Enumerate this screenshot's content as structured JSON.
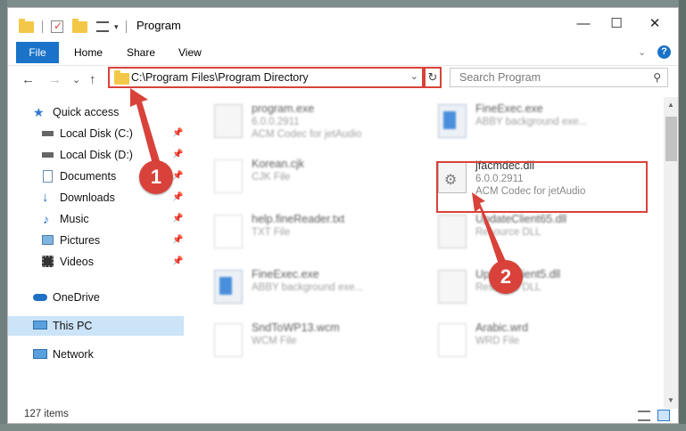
{
  "window": {
    "title": "Program",
    "controls": {
      "minimize": "—",
      "maximize": "☐",
      "close": "✕"
    }
  },
  "ribbon": {
    "tabs": [
      "File",
      "Home",
      "Share",
      "View"
    ],
    "help": "?"
  },
  "address": {
    "path": "C:\\Program Files\\Program Directory",
    "dropdown": "⌄",
    "refresh": "↻"
  },
  "search": {
    "placeholder": "Search Program",
    "icon": "search-icon"
  },
  "nav_buttons": {
    "back": "←",
    "forward": "→",
    "recent": "⌄",
    "up": "↑"
  },
  "sidebar": {
    "items": [
      {
        "label": "Quick access",
        "icon": "star-icon",
        "pinned": false
      },
      {
        "label": "Local Disk (C:)",
        "icon": "drive-icon",
        "pinned": true
      },
      {
        "label": "Local Disk (D:)",
        "icon": "drive-icon",
        "pinned": true
      },
      {
        "label": "Documents",
        "icon": "documents-icon",
        "pinned": true
      },
      {
        "label": "Downloads",
        "icon": "downloads-icon",
        "pinned": true
      },
      {
        "label": "Music",
        "icon": "music-icon",
        "pinned": true
      },
      {
        "label": "Pictures",
        "icon": "pictures-icon",
        "pinned": true
      },
      {
        "label": "Videos",
        "icon": "videos-icon",
        "pinned": true
      },
      {
        "label": "OneDrive",
        "icon": "cloud-icon",
        "pinned": false
      },
      {
        "label": "This PC",
        "icon": "computer-icon",
        "pinned": false,
        "selected": true
      },
      {
        "label": "Network",
        "icon": "network-icon",
        "pinned": false
      }
    ],
    "pin_glyph": "📌"
  },
  "files": [
    {
      "name": "program.exe",
      "line2": "6.0.0.2911",
      "line3": "ACM Codec for jetAudio",
      "icon": "setup-icon"
    },
    {
      "name": "FineExec.exe",
      "line2": "ABBY background exe...",
      "line3": "",
      "icon": "app-window-icon"
    },
    {
      "name": "Korean.cjk",
      "line2": "CJK File",
      "line3": "",
      "icon": "file-icon"
    },
    {
      "name": "jfacmdec.dll",
      "line2": "6.0.0.2911",
      "line3": "ACM Codec for jetAudio",
      "icon": "dll-gear-icon"
    },
    {
      "name": "help.fineReader.txt",
      "line2": "TXT File",
      "line3": "",
      "icon": "file-icon"
    },
    {
      "name": "UpdateClient65.dll",
      "line2": "Resource DLL",
      "line3": "",
      "icon": "dll-gear-icon"
    },
    {
      "name": "FineExec.exe",
      "line2": "ABBY background exe...",
      "line3": "",
      "icon": "app-window-icon"
    },
    {
      "name": "UpdateClient5.dll",
      "line2": "Resource DLL",
      "line3": "",
      "icon": "dll-gear-icon"
    },
    {
      "name": "SndToWP13.wcm",
      "line2": "WCM File",
      "line3": "",
      "icon": "file-icon"
    },
    {
      "name": "Arabic.wrd",
      "line2": "WRD File",
      "line3": "",
      "icon": "file-icon"
    }
  ],
  "status": {
    "count": "127 items"
  },
  "annotations": {
    "step1": "1",
    "step2": "2",
    "color": "#d9423a"
  }
}
